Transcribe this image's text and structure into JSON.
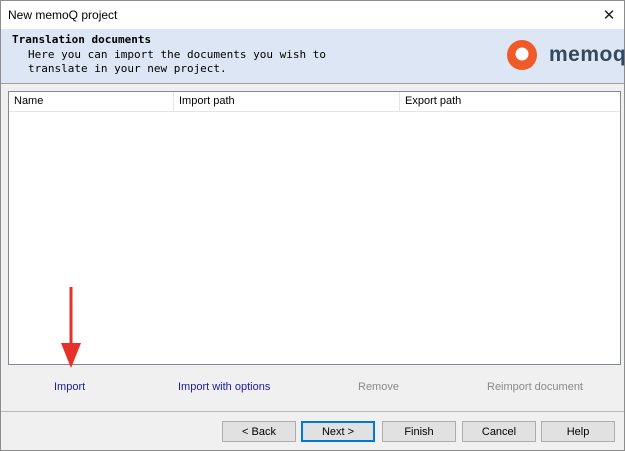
{
  "window": {
    "title": "New memoQ project",
    "close_glyph": "✕"
  },
  "header": {
    "title": "Translation documents",
    "description": "Here you can import the documents you wish to translate in your new project.",
    "logo_text": "memoq",
    "logo_color": "#f05a28"
  },
  "listview": {
    "columns": [
      "Name",
      "Import path",
      "Export path"
    ],
    "rows": []
  },
  "actions": {
    "import": "Import",
    "import_with_options": "Import with options",
    "remove": "Remove",
    "reimport_document": "Reimport document"
  },
  "buttons": {
    "back": "< Back",
    "next": "Next >",
    "finish": "Finish",
    "cancel": "Cancel",
    "help": "Help"
  },
  "annotation": {
    "arrow_color": "#e8302a"
  }
}
